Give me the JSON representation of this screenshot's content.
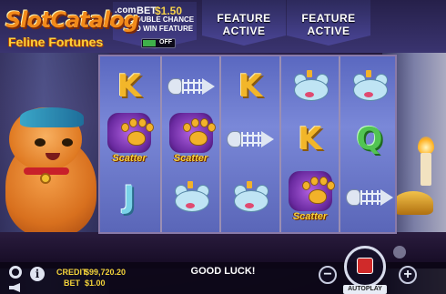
{
  "logo": {
    "main": "SlotCatalog",
    "domain": ".com",
    "subtitle": "Feline Fortunes"
  },
  "bet_feature": {
    "label": "BET",
    "value": "$1.50",
    "description": "DOUBLE CHANCE TO WIN FEATURE",
    "toggle_state": "OFF"
  },
  "feature_flags": [
    "FEATURE ACTIVE",
    "FEATURE ACTIVE"
  ],
  "reels": [
    [
      {
        "type": "letter",
        "value": "K"
      },
      {
        "type": "scatter",
        "value": "Scatter"
      },
      {
        "type": "letter",
        "value": "J"
      }
    ],
    [
      {
        "type": "fish",
        "value": "fish-bone"
      },
      {
        "type": "scatter",
        "value": "Scatter"
      },
      {
        "type": "mouse",
        "value": "mouse"
      }
    ],
    [
      {
        "type": "letter",
        "value": "K"
      },
      {
        "type": "fish",
        "value": "fish-bone"
      },
      {
        "type": "mouse",
        "value": "mouse"
      }
    ],
    [
      {
        "type": "mouse",
        "value": "mouse"
      },
      {
        "type": "letter",
        "value": "K"
      },
      {
        "type": "scatter",
        "value": "Scatter"
      }
    ],
    [
      {
        "type": "mouse",
        "value": "mouse"
      },
      {
        "type": "letter",
        "value": "Q"
      },
      {
        "type": "fish",
        "value": "fish-bone"
      }
    ]
  ],
  "status": {
    "credit_label": "CREDIT",
    "credit_value": "$99,720.20",
    "bet_label": "BET",
    "bet_value": "$1.00",
    "message": "GOOD LUCK!"
  },
  "controls": {
    "minus": "−",
    "plus": "+",
    "autoplay": "AUTOPLAY",
    "info": "i"
  },
  "colors": {
    "credit_text": "#f2d23a",
    "scatter_text": "#f7d23a"
  }
}
